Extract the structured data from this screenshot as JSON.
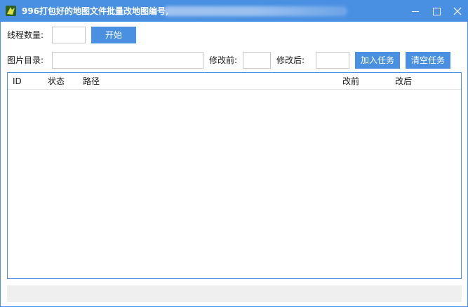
{
  "window": {
    "title": "996打包好的地图文件批量改地图编号,",
    "accent_color": "#4a90e2",
    "icons": [
      "app-icon",
      "minimize-icon",
      "maximize-icon",
      "close-icon"
    ]
  },
  "row1": {
    "thread_label": "线程数量:",
    "thread_value": "",
    "start_button": "开始"
  },
  "row2": {
    "dir_label": "图片目录:",
    "dir_value": "",
    "before_label": "修改前:",
    "before_value": "",
    "after_label": "修改后:",
    "after_value": "",
    "add_button": "加入任务",
    "clear_button": "清空任务"
  },
  "table": {
    "columns": [
      "ID",
      "状态",
      "路径",
      "改前",
      "改后"
    ],
    "rows": []
  },
  "status": {
    "text": ""
  }
}
